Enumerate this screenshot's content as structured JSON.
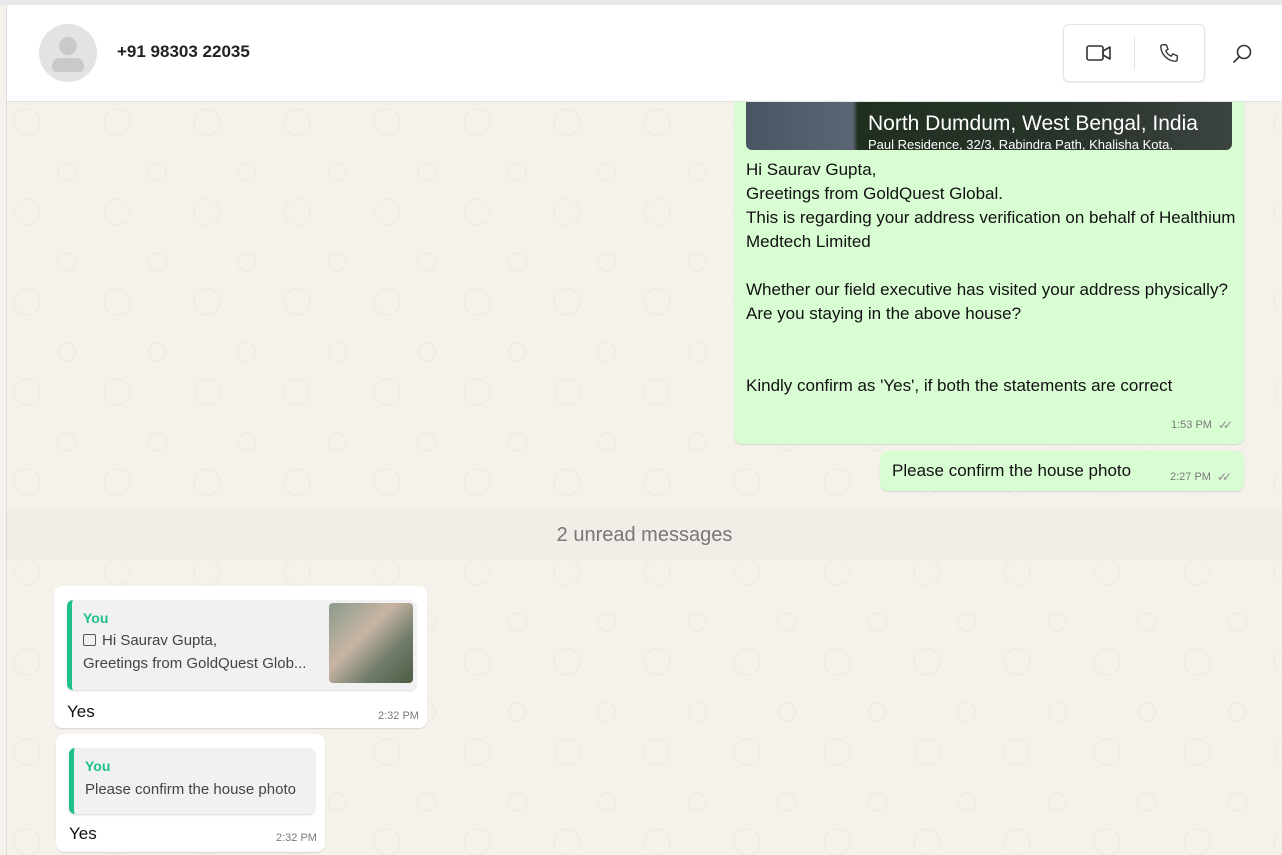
{
  "header": {
    "contact": "+91 98303 22035"
  },
  "messages": {
    "outgoing": [
      {
        "location_title": "North Dumdum, West Bengal, India",
        "location_address": "Paul Residence, 32/3, Rabindra Path, Khalisha Kota,",
        "text": "Hi Saurav Gupta,\nGreetings from GoldQuest Global.\nThis is regarding your address verification on behalf of Healthium Medtech Limited\n\nWhether our field executive has visited your address physically?\nAre you staying in the above house?\n\n\nKindly confirm as 'Yes', if both the statements are correct",
        "time": "1:53 PM"
      },
      {
        "text": "Please confirm the house photo",
        "time": "2:27 PM"
      }
    ],
    "unread_divider": "2 unread messages",
    "incoming": [
      {
        "quote_author": "You",
        "quote_line1": "Hi Saurav Gupta,",
        "quote_line2": "Greetings from GoldQuest Glob...",
        "text": "Yes",
        "time": "2:32 PM"
      },
      {
        "quote_author": "You",
        "quote_line1": "Please confirm the house photo",
        "text": "Yes",
        "time": "2:32 PM"
      }
    ]
  },
  "colors": {
    "outgoing_bubble": "#d9fdd3",
    "quote_accent": "#21c08a"
  }
}
